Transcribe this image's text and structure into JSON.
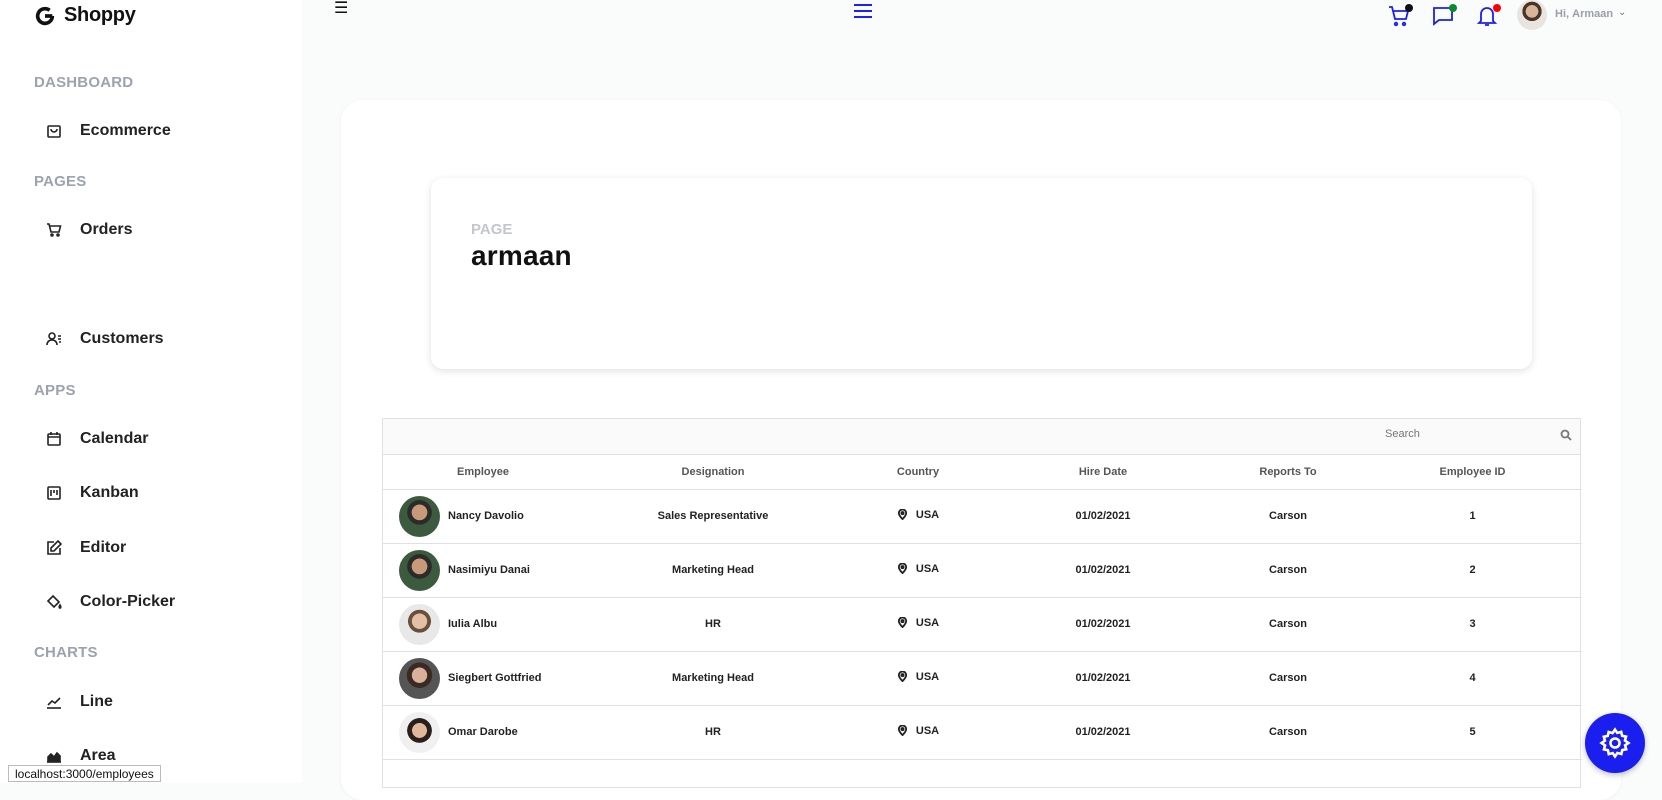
{
  "brand": {
    "name": "Shoppy"
  },
  "sidebar": {
    "sections": [
      {
        "title": "DASHBOARD",
        "items": [
          {
            "label": "Ecommerce",
            "icon": "shopping-bag-icon"
          }
        ]
      },
      {
        "title": "PAGES",
        "items": [
          {
            "label": "Orders",
            "icon": "cart-icon"
          },
          {
            "label": "Customers",
            "icon": "customers-icon"
          }
        ]
      },
      {
        "title": "APPS",
        "items": [
          {
            "label": "Calendar",
            "icon": "calendar-icon"
          },
          {
            "label": "Kanban",
            "icon": "kanban-icon"
          },
          {
            "label": "Editor",
            "icon": "edit-icon"
          },
          {
            "label": "Color-Picker",
            "icon": "paint-bucket-icon"
          }
        ]
      },
      {
        "title": "CHARTS",
        "items": [
          {
            "label": "Line",
            "icon": "line-chart-icon"
          },
          {
            "label": "Area",
            "icon": "area-chart-icon"
          }
        ]
      }
    ]
  },
  "topbar": {
    "greeting_prefix": "Hi,",
    "user_name": "Armaan",
    "badge_colors": {
      "cart": "#111111",
      "chat": "#03c9d7",
      "notification": "#ff0000"
    }
  },
  "header": {
    "category": "PAGE",
    "title": "armaan"
  },
  "grid": {
    "search_placeholder": "Search",
    "columns": [
      "Employee",
      "Designation",
      "Country",
      "Hire Date",
      "Reports To",
      "Employee ID"
    ],
    "rows": [
      {
        "name": "Nancy Davolio",
        "designation": "Sales Representative",
        "country": "USA",
        "hire_date": "01/02/2021",
        "reports_to": "Carson",
        "id": "1"
      },
      {
        "name": "Nasimiyu Danai",
        "designation": "Marketing Head",
        "country": "USA",
        "hire_date": "01/02/2021",
        "reports_to": "Carson",
        "id": "2"
      },
      {
        "name": "Iulia Albu",
        "designation": "HR",
        "country": "USA",
        "hire_date": "01/02/2021",
        "reports_to": "Carson",
        "id": "3"
      },
      {
        "name": "Siegbert Gottfried",
        "designation": "Marketing Head",
        "country": "USA",
        "hire_date": "01/02/2021",
        "reports_to": "Carson",
        "id": "4"
      },
      {
        "name": "Omar Darobe",
        "designation": "HR",
        "country": "USA",
        "hire_date": "01/02/2021",
        "reports_to": "Carson",
        "id": "5"
      }
    ]
  },
  "status_bar": {
    "url": "localhost:3000/employees"
  },
  "colors": {
    "accent": "#1a1ff0"
  }
}
